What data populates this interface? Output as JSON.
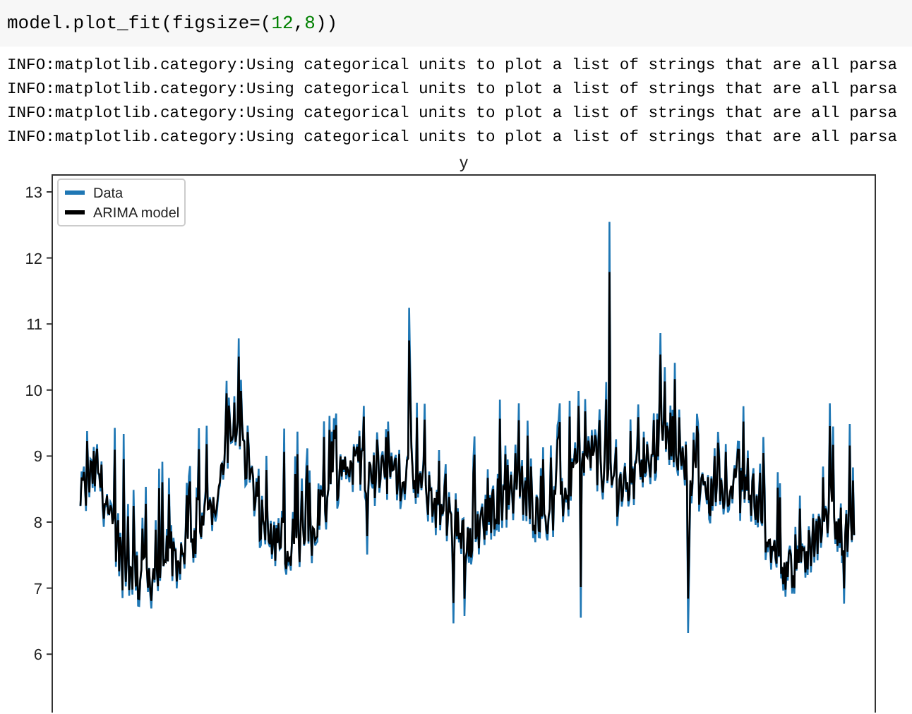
{
  "code_cell": {
    "tokens": [
      {
        "kind": "plain",
        "text": "model.plot_fit(figsize=("
      },
      {
        "kind": "number",
        "text": "12"
      },
      {
        "kind": "plain",
        "text": ","
      },
      {
        "kind": "number",
        "text": "8"
      },
      {
        "kind": "plain",
        "text": "))"
      }
    ]
  },
  "output_lines": [
    "INFO:matplotlib.category:Using categorical units to plot a list of strings that are all parsa",
    "INFO:matplotlib.category:Using categorical units to plot a list of strings that are all parsa",
    "INFO:matplotlib.category:Using categorical units to plot a list of strings that are all parsa",
    "INFO:matplotlib.category:Using categorical units to plot a list of strings that are all parsa"
  ],
  "plot": {
    "title": "y",
    "yticks": [
      "13",
      "12",
      "11",
      "10",
      "9",
      "8",
      "7",
      "6"
    ],
    "legend": [
      {
        "label": "Data",
        "color": "#1f77b4"
      },
      {
        "label": "ARIMA model",
        "color": "#000000"
      }
    ]
  }
}
